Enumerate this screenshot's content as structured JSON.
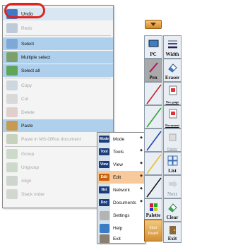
{
  "edit_menu": {
    "items": [
      {
        "label": "Undo"
      },
      {
        "label": "Redo"
      },
      {
        "label": "Select"
      },
      {
        "label": "Multiple select"
      },
      {
        "label": "Select all"
      },
      {
        "label": "Copy"
      },
      {
        "label": "Cut"
      },
      {
        "label": "Delete"
      },
      {
        "label": "Paste"
      },
      {
        "label": "Paste in MS-Office document"
      },
      {
        "label": "Group"
      },
      {
        "label": "Ungroup"
      },
      {
        "label": "Align"
      },
      {
        "label": "Stack order"
      }
    ]
  },
  "start_menu": {
    "items": [
      {
        "badge": "Mode",
        "label": "Mode"
      },
      {
        "badge": "Tool",
        "label": "Tools"
      },
      {
        "badge": "View",
        "label": "View"
      },
      {
        "badge": "Edit",
        "label": "Edit"
      },
      {
        "badge": "Net",
        "label": "Network"
      },
      {
        "badge": "Doc",
        "label": "Documents"
      },
      {
        "label": "Settings"
      },
      {
        "label": "Help"
      },
      {
        "label": "Exit"
      }
    ]
  },
  "toolbar": {
    "pc": "PC",
    "width": "Width",
    "pen": "Pen",
    "eraser": "Eraser",
    "new_page": "New page",
    "document": "Document",
    "pointer": "Pointer",
    "list": "List",
    "next": "Next",
    "clear": "Clear",
    "palette": "Palette",
    "exit": "Exit",
    "start_board": "Start Board"
  },
  "colors": {
    "highlight": "#aed0ec",
    "active": "#f8c99a",
    "undo_ring": "#e0241f"
  }
}
